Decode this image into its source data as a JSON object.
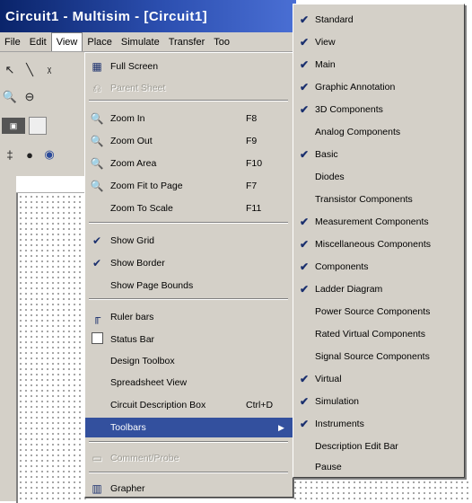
{
  "window": {
    "title": "Circuit1 - Multisim - [Circuit1]"
  },
  "menubar": {
    "items": [
      {
        "label": "File"
      },
      {
        "label": "Edit"
      },
      {
        "label": "View"
      },
      {
        "label": "Place"
      },
      {
        "label": "Simulate"
      },
      {
        "label": "Transfer"
      },
      {
        "label": "Too"
      }
    ]
  },
  "view_menu": {
    "items": [
      {
        "label": "Full Screen",
        "icon": "full-screen-icon",
        "shortcut": "",
        "enabled": true
      },
      {
        "label": "Parent Sheet",
        "icon": "parent-sheet-icon",
        "shortcut": "",
        "enabled": false
      },
      {
        "label": "Zoom In",
        "icon": "zoom-in-icon",
        "shortcut": "F8",
        "enabled": true
      },
      {
        "label": "Zoom Out",
        "icon": "zoom-out-icon",
        "shortcut": "F9",
        "enabled": true
      },
      {
        "label": "Zoom Area",
        "icon": "zoom-area-icon",
        "shortcut": "F10",
        "enabled": true
      },
      {
        "label": "Zoom Fit to Page",
        "icon": "zoom-fit-icon",
        "shortcut": "F7",
        "enabled": true
      },
      {
        "label": "Zoom To Scale",
        "icon": "",
        "shortcut": "F11",
        "enabled": true
      },
      {
        "label": "Show Grid",
        "icon": "check-icon",
        "shortcut": "",
        "enabled": true,
        "checked": true
      },
      {
        "label": "Show Border",
        "icon": "check-icon",
        "shortcut": "",
        "enabled": true,
        "checked": true
      },
      {
        "label": "Show Page Bounds",
        "icon": "",
        "shortcut": "",
        "enabled": true
      },
      {
        "label": "Ruler bars",
        "icon": "ruler-icon",
        "shortcut": "",
        "enabled": true
      },
      {
        "label": "Status Bar",
        "icon": "checkbox-icon",
        "shortcut": "",
        "enabled": true
      },
      {
        "label": "Design Toolbox",
        "icon": "",
        "shortcut": "",
        "enabled": true
      },
      {
        "label": "Spreadsheet View",
        "icon": "",
        "shortcut": "",
        "enabled": true
      },
      {
        "label": "Circuit Description Box",
        "icon": "",
        "shortcut": "Ctrl+D",
        "enabled": true
      },
      {
        "label": "Toolbars",
        "icon": "",
        "shortcut": "",
        "enabled": true,
        "highlighted": true
      },
      {
        "label": "Comment/Probe",
        "icon": "comment-icon",
        "shortcut": "",
        "enabled": false
      },
      {
        "label": "Grapher",
        "icon": "grapher-icon",
        "shortcut": "",
        "enabled": true
      }
    ]
  },
  "toolbars_menu": {
    "items": [
      {
        "label": "Standard",
        "checked": true
      },
      {
        "label": "View",
        "checked": true
      },
      {
        "label": "Main",
        "checked": true
      },
      {
        "label": "Graphic Annotation",
        "checked": true
      },
      {
        "label": "3D Components",
        "checked": true
      },
      {
        "label": "Analog Components",
        "checked": false
      },
      {
        "label": "Basic",
        "checked": true
      },
      {
        "label": "Diodes",
        "checked": false
      },
      {
        "label": "Transistor Components",
        "checked": false
      },
      {
        "label": "Measurement Components",
        "checked": true
      },
      {
        "label": "Miscellaneous Components",
        "checked": true
      },
      {
        "label": "Components",
        "checked": true
      },
      {
        "label": "Ladder Diagram",
        "checked": true
      },
      {
        "label": "Power Source Components",
        "checked": false
      },
      {
        "label": "Rated Virtual Components",
        "checked": false
      },
      {
        "label": "Signal Source Components",
        "checked": false
      },
      {
        "label": "Virtual",
        "checked": true
      },
      {
        "label": "Simulation",
        "checked": true
      },
      {
        "label": "Instruments",
        "checked": true
      },
      {
        "label": "Description Edit Bar",
        "checked": false
      },
      {
        "label": "Pause",
        "checked": false
      }
    ]
  }
}
